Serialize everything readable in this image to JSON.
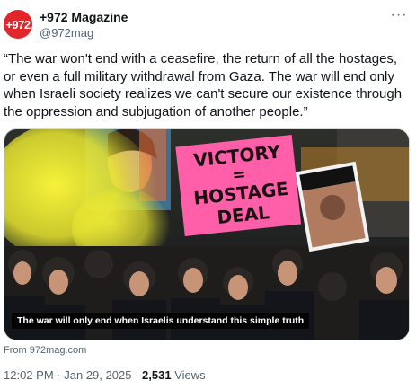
{
  "author": {
    "avatar_text": "+972",
    "display_name": "+972 Magazine",
    "handle": "@972mag",
    "avatar_color": "#e3262b"
  },
  "more_icon": "more-horizontal-icon",
  "tweet": {
    "text": "“The war won't end with a ceasefire, the return of all the hostages, or even a full military withdrawal from Gaza. The war will end only when Israeli society realizes we can't secure our existence through the oppression and subjugation of another people.”"
  },
  "media": {
    "caption": "The war will only end when Israelis understand this simple truth",
    "sign_text": [
      "VICTORY",
      "=",
      "HOSTAGE",
      "DEAL"
    ],
    "sign_color": "#ff5fa8",
    "smoke_color": "#f3ef2e"
  },
  "source": {
    "label": "From 972mag.com"
  },
  "meta": {
    "time": "12:02 PM",
    "separator": "·",
    "date": "Jan 29, 2025",
    "views_count": "2,531",
    "views_label": "Views"
  }
}
